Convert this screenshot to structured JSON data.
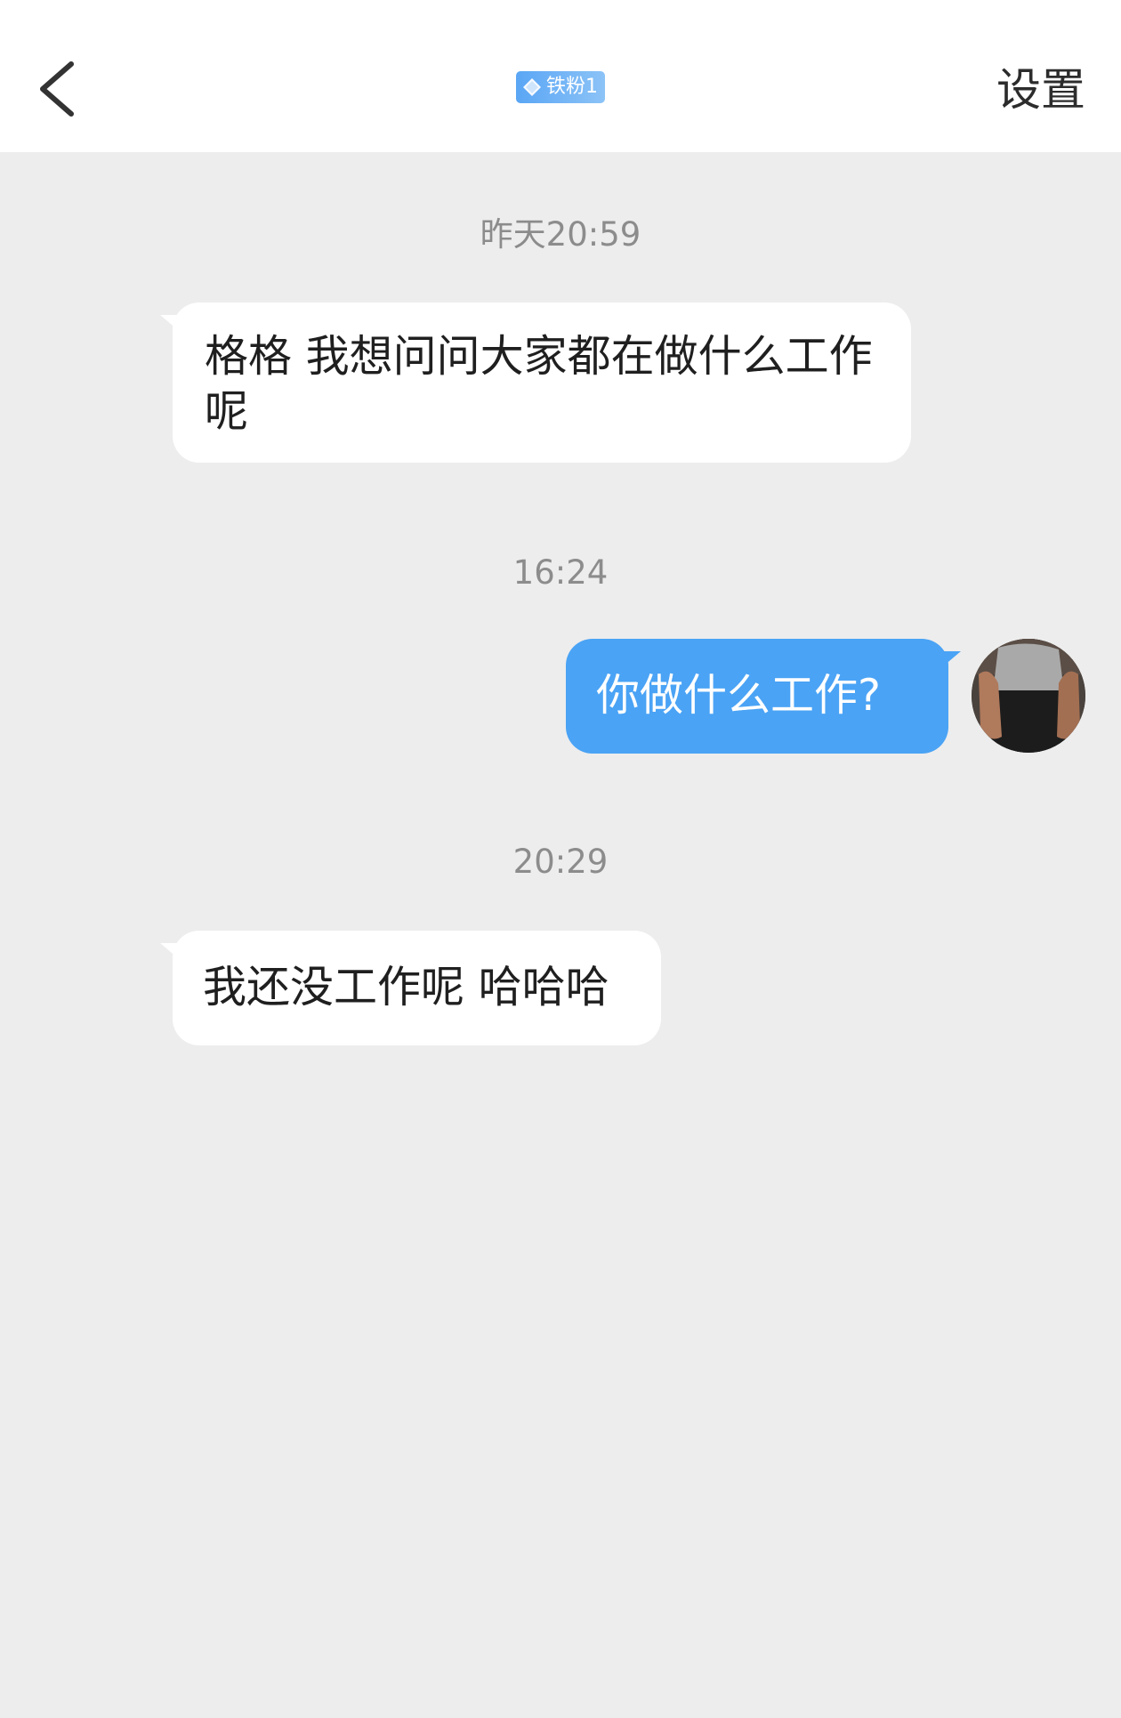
{
  "header": {
    "badge_text": "铁粉1",
    "settings_label": "设置",
    "back_icon": "chevron-left-icon"
  },
  "colors": {
    "header_bg": "#ffffff",
    "chat_bg": "#ededed",
    "incoming_bubble": "#ffffff",
    "outgoing_bubble": "#4aa3f5",
    "badge": "#5aa6f5"
  },
  "messages": [
    {
      "timestamp": "昨天20:59",
      "direction": "incoming",
      "text": "格格 我想问问大家都在做什么工作呢"
    },
    {
      "timestamp": "16:24",
      "direction": "outgoing",
      "text": "你做什么工作?"
    },
    {
      "timestamp": "20:29",
      "direction": "incoming",
      "text": "我还没工作呢 哈哈哈"
    }
  ]
}
